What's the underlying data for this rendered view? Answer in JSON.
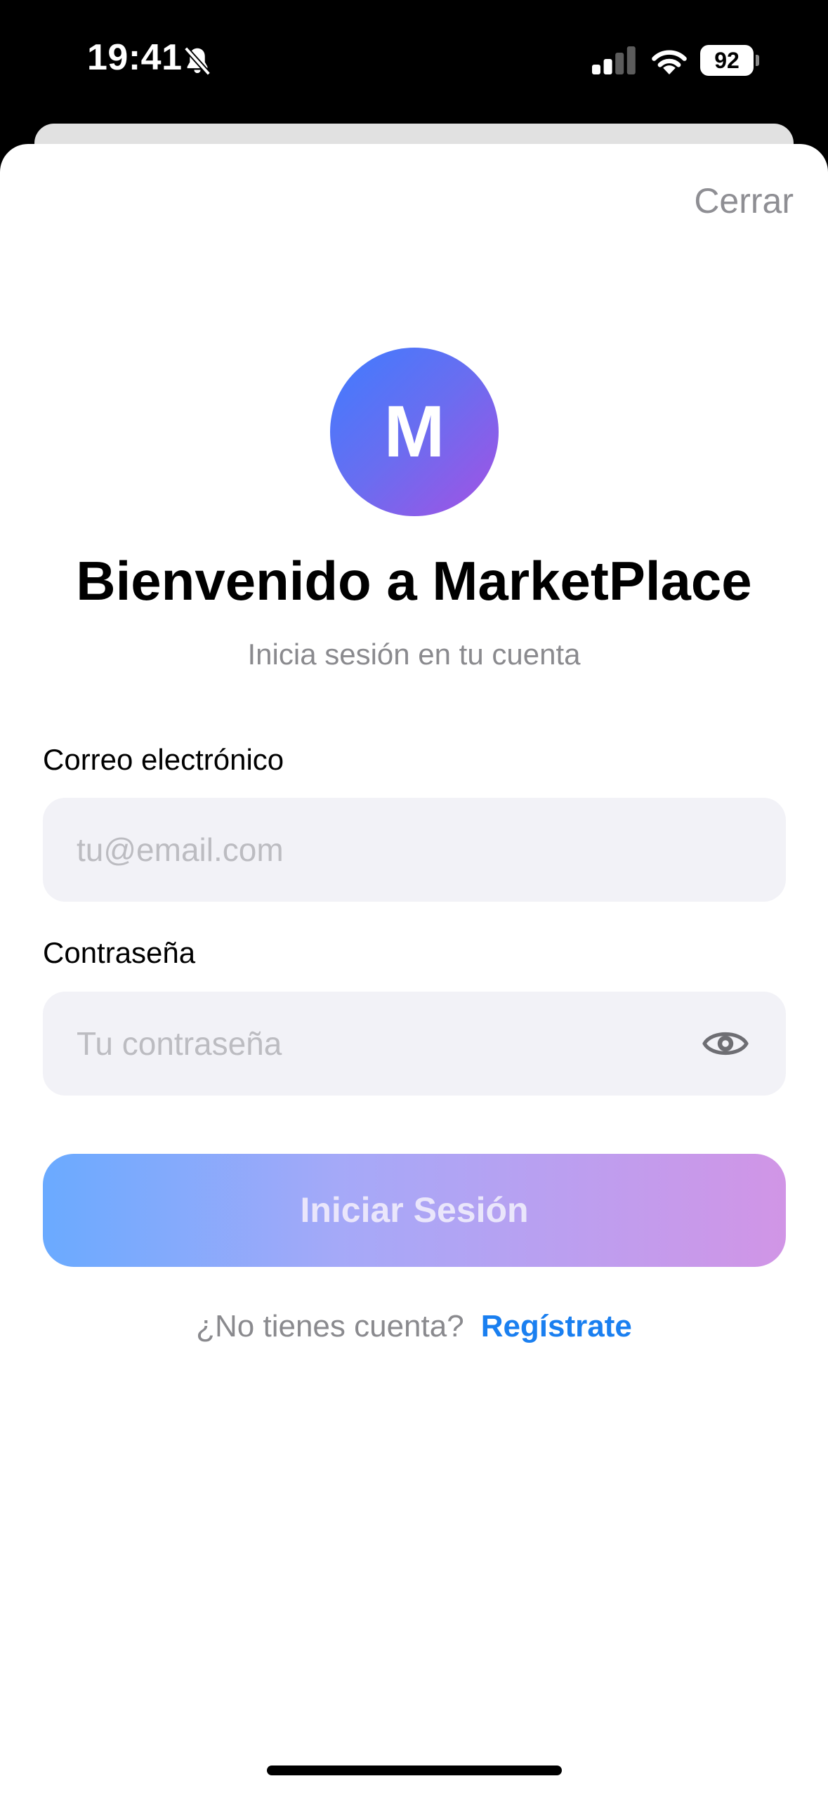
{
  "status_bar": {
    "time": "19:41",
    "battery_level": "92",
    "icons": [
      "bell-off-icon",
      "signal-icon",
      "wifi-icon",
      "battery-icon"
    ]
  },
  "sheet": {
    "close_label": "Cerrar"
  },
  "logo": {
    "letter": "M",
    "gradient_colors": [
      "#3f7cff",
      "#a451e3"
    ]
  },
  "header": {
    "title": "Bienvenido a MarketPlace",
    "subtitle": "Inicia sesión en tu cuenta"
  },
  "form": {
    "email": {
      "label": "Correo electrónico",
      "placeholder": "tu@email.com",
      "value": ""
    },
    "password": {
      "label": "Contraseña",
      "placeholder": "Tu contraseña",
      "value": "",
      "toggle_icon": "eye-icon"
    },
    "submit_label": "Iniciar Sesión"
  },
  "footer": {
    "prompt": "¿No tienes cuenta?",
    "link_label": "Regístrate",
    "link_color": "#1a7ff0"
  }
}
